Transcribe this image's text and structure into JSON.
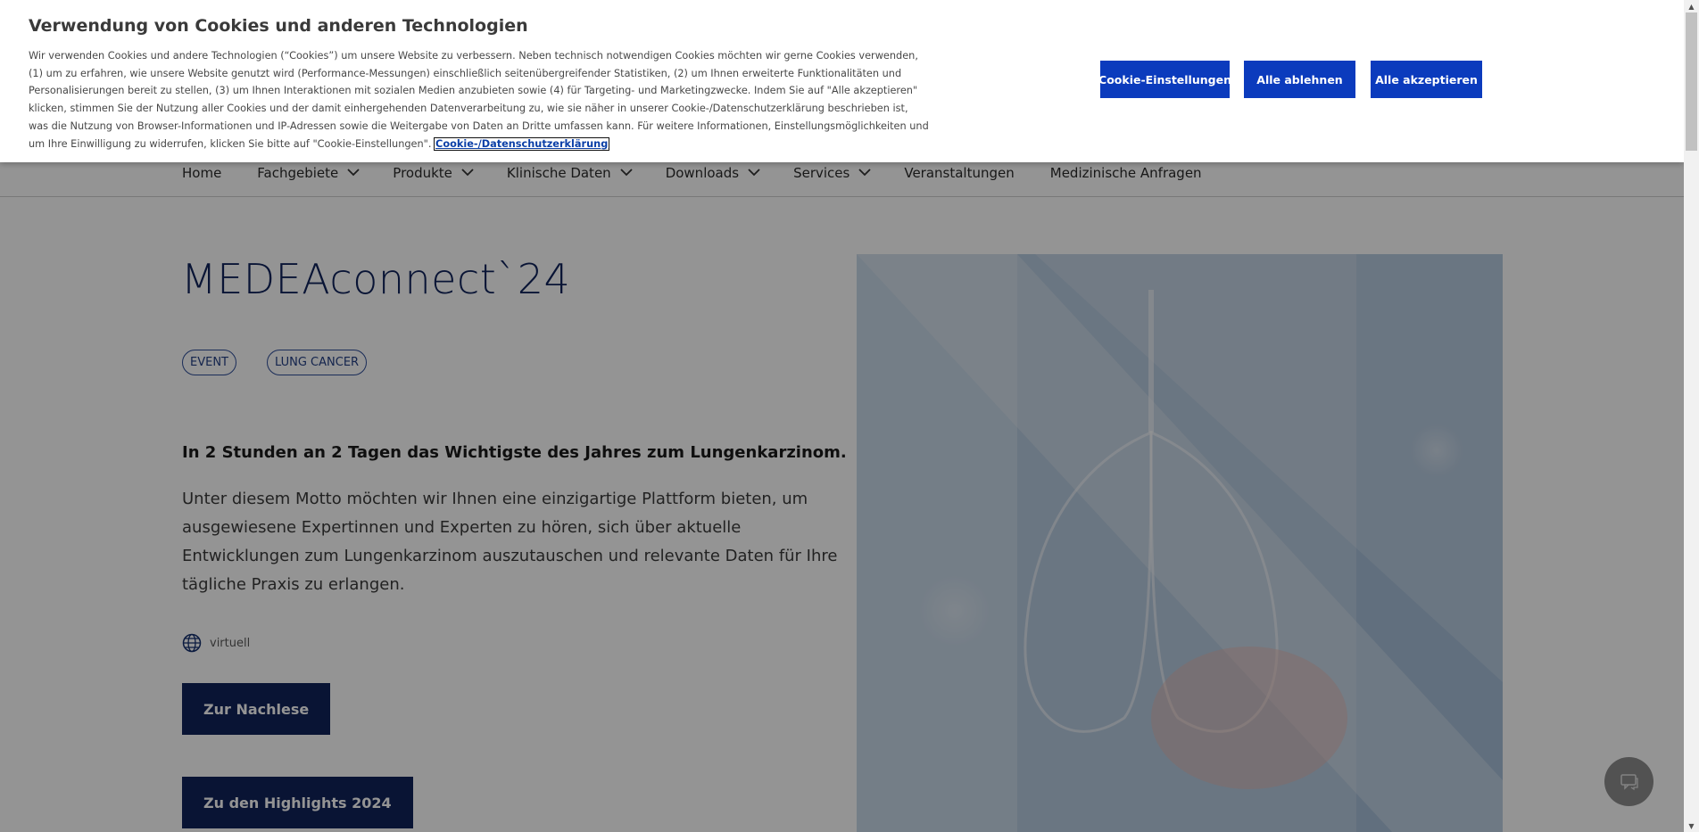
{
  "cookie_banner": {
    "title": "Verwendung von Cookies und anderen Technologien",
    "text": "Wir verwenden Cookies und andere Technologien (“Cookies”) um unsere Website zu verbessern. Neben technisch notwendigen Cookies möchten wir gerne Cookies verwenden, (1) um zu erfahren, wie unsere Website genutzt wird (Performance-Messungen) einschließlich seitenübergreifender Statistiken, (2) um Ihnen erweiterte Funktionalitäten und Personalisierungen bereit zu stellen, (3) um Ihnen Interaktionen mit sozialen Medien anzubieten sowie (4) für Targeting- und Marketingzwecke. Indem Sie auf \"Alle akzeptieren\" klicken, stimmen Sie der Nutzung aller Cookies und der damit einhergehenden Datenverarbeitung zu, wie sie näher in unserer Cookie-/Datenschutzerklärung beschrieben ist, was die Nutzung von Browser-Informationen und IP-Adressen sowie die Weitergabe von Daten an Dritte umfassen kann. Für weitere Informationen, Einstellungsmöglichkeiten und um Ihre Einwilligung zu widerrufen, klicken Sie bitte auf \"Cookie-Einstellungen\".",
    "link_label": "Cookie-/Datenschutzerklärung",
    "settings_label": "Cookie-Einstellungen",
    "reject_label": "Alle ablehnen",
    "accept_label": "Alle akzeptieren",
    "button_color": "#0b3bbd"
  },
  "nav": {
    "items": [
      {
        "label": "Home",
        "dropdown": false
      },
      {
        "label": "Fachgebiete",
        "dropdown": true
      },
      {
        "label": "Produkte",
        "dropdown": true
      },
      {
        "label": "Klinische Daten",
        "dropdown": true
      },
      {
        "label": "Downloads",
        "dropdown": true
      },
      {
        "label": "Services",
        "dropdown": true
      },
      {
        "label": "Veranstaltungen",
        "dropdown": false
      },
      {
        "label": "Medizinische Anfragen",
        "dropdown": false
      }
    ]
  },
  "hero": {
    "title": "MEDEAconnect`24",
    "tags": [
      "EVENT",
      "LUNG CANCER"
    ],
    "lead": "In 2 Stunden an 2 Tagen das Wichtigste des Jahres zum Lungenkarzinom.",
    "body": "Unter diesem Motto möchten wir Ihnen eine einzigartige Plattform bieten, um ausgewiesene Expertinnen und Experten zu hören, sich über aktuelle Entwicklungen zum Lungenkarzinom auszutauschen und relevante Daten für Ihre tägliche Praxis zu erlangen.",
    "location_icon": "globe-icon",
    "location": "virtuell",
    "button_primary": "Zur Nachlese",
    "button_secondary": "Zu den Highlights 2024",
    "accent_color": "#11245a"
  },
  "chat": {
    "icon": "chat-icon"
  }
}
